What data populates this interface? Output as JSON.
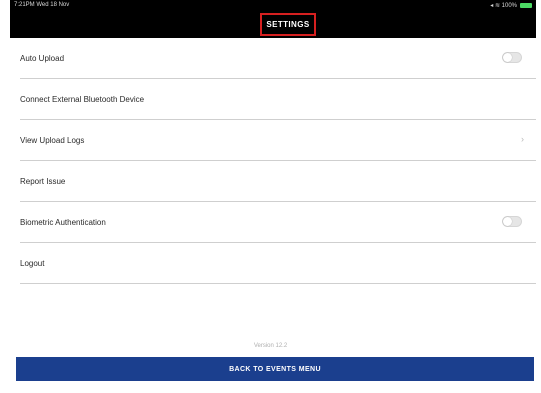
{
  "status_bar": {
    "time": "7:21PM  Wed 18 Nov",
    "signal": "◂ ≋ 100%",
    "battery_color": "#4cd964"
  },
  "header": {
    "title": "SETTINGS",
    "highlight_color": "#d62020"
  },
  "settings": {
    "items": [
      {
        "label": "Auto Upload",
        "control": "toggle",
        "on": false
      },
      {
        "label": "Connect External Bluetooth Device",
        "control": "none"
      },
      {
        "label": "View Upload Logs",
        "control": "chevron",
        "chevron": "›"
      },
      {
        "label": "Report Issue",
        "control": "none"
      },
      {
        "label": "Biometric Authentication",
        "control": "toggle",
        "on": false
      },
      {
        "label": "Logout",
        "control": "none"
      }
    ]
  },
  "footer": {
    "version": "Version 12.2",
    "back_button_label": "BACK TO EVENTS MENU",
    "button_color": "#1b3f8e"
  }
}
